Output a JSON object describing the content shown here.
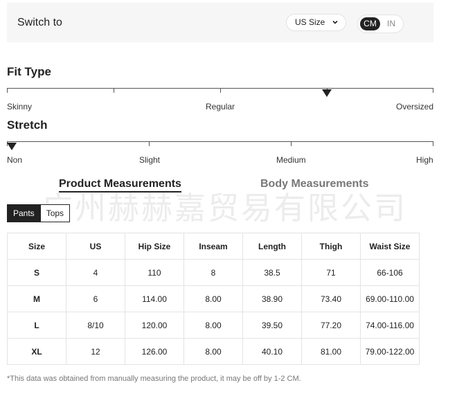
{
  "switch": {
    "label": "Switch to",
    "size_select": "US Size",
    "unit_active": "CM",
    "unit_inactive": "IN"
  },
  "fit_type": {
    "title": "Fit Type",
    "labels": [
      "Skinny",
      "Regular",
      "Oversized"
    ],
    "marker_position": 0.75
  },
  "stretch": {
    "title": "Stretch",
    "labels": [
      "Non",
      "Slight",
      "Medium",
      "High"
    ],
    "marker_position": 0.0
  },
  "tabs": {
    "product": "Product Measurements",
    "body": "Body Measurements"
  },
  "watermark": "广州赫赫嘉贸易有限公司",
  "sub_tabs": {
    "pants": "Pants",
    "tops": "Tops"
  },
  "table": {
    "headers": [
      "Size",
      "US",
      "Hip Size",
      "Inseam",
      "Length",
      "Thigh",
      "Waist Size"
    ],
    "rows": [
      [
        "S",
        "4",
        "110",
        "8",
        "38.5",
        "71",
        "66-106"
      ],
      [
        "M",
        "6",
        "114.00",
        "8.00",
        "38.90",
        "73.40",
        "69.00-110.00"
      ],
      [
        "L",
        "8/10",
        "120.00",
        "8.00",
        "39.50",
        "77.20",
        "74.00-116.00"
      ],
      [
        "XL",
        "12",
        "126.00",
        "8.00",
        "40.10",
        "81.00",
        "79.00-122.00"
      ]
    ]
  },
  "footnote": "*This data was obtained from manually measuring the product, it may be off by 1-2 CM.",
  "colors": {
    "accent": "#222222",
    "panel": "#f6f6f6",
    "border": "#e3e3e3"
  }
}
